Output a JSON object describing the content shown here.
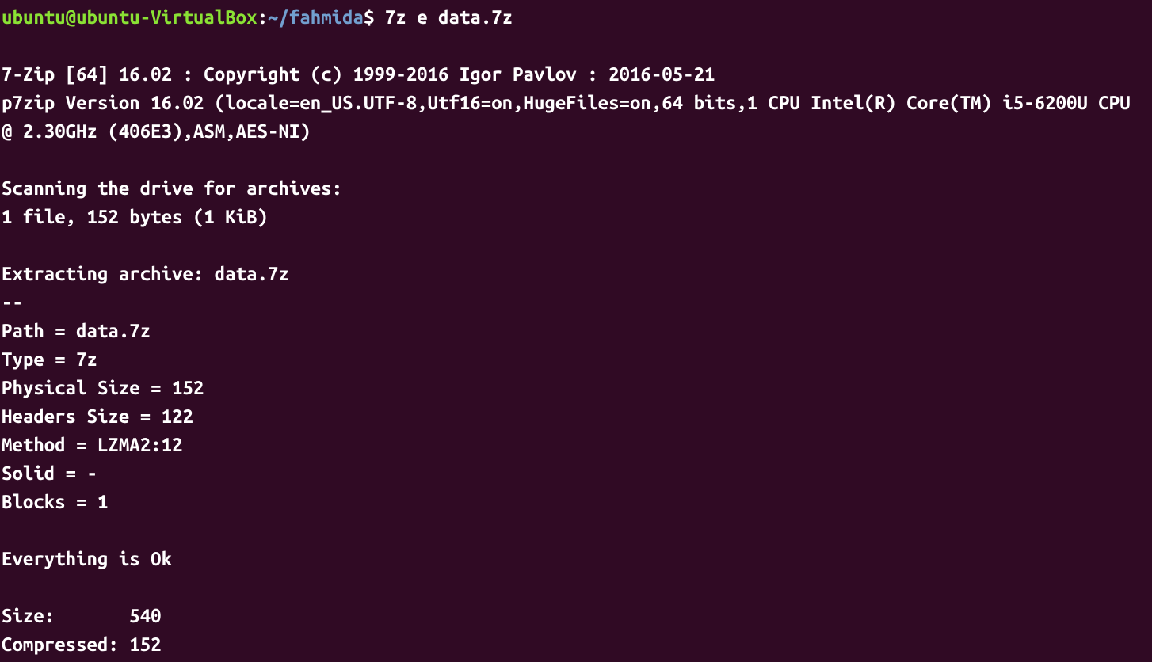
{
  "prompt": {
    "user_host": "ubuntu@ubuntu-VirtualBox",
    "colon": ":",
    "path": "~/fahmida",
    "dollar": "$ ",
    "command": "7z e data.7z"
  },
  "output": {
    "blank1": "",
    "line1": "7-Zip [64] 16.02 : Copyright (c) 1999-2016 Igor Pavlov : 2016-05-21",
    "line2": "p7zip Version 16.02 (locale=en_US.UTF-8,Utf16=on,HugeFiles=on,64 bits,1 CPU Intel(R) Core(TM) i5-6200U CPU @ 2.30GHz (406E3),ASM,AES-NI)",
    "blank2": "",
    "line3": "Scanning the drive for archives:",
    "line4": "1 file, 152 bytes (1 KiB)",
    "blank3": "",
    "line5": "Extracting archive: data.7z",
    "line6": "--",
    "line7": "Path = data.7z",
    "line8": "Type = 7z",
    "line9": "Physical Size = 152",
    "line10": "Headers Size = 122",
    "line11": "Method = LZMA2:12",
    "line12": "Solid = -",
    "line13": "Blocks = 1",
    "blank4": "",
    "line14": "Everything is Ok",
    "blank5": "",
    "line15": "Size:       540",
    "line16": "Compressed: 152"
  }
}
